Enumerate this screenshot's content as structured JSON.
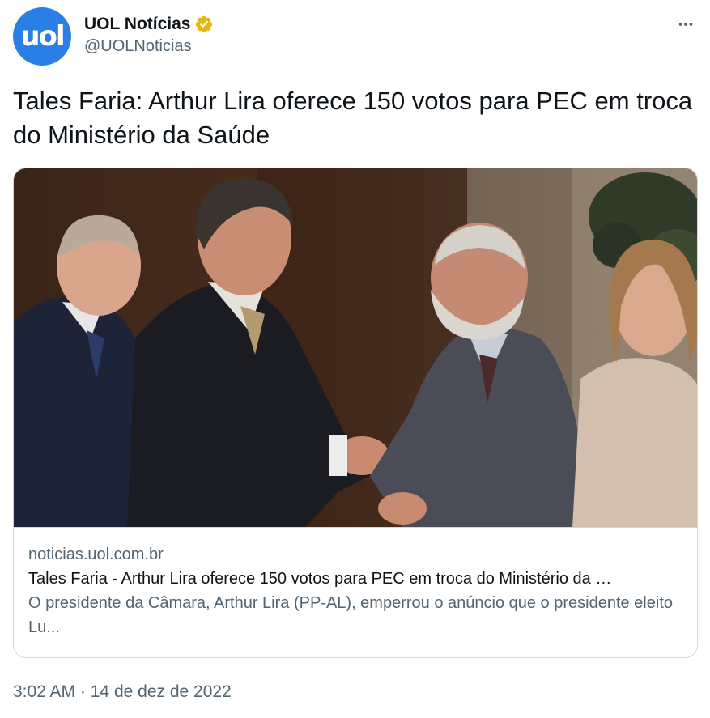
{
  "author": {
    "avatar_text": "uol",
    "display_name": "UOL Notícias",
    "handle": "@UOLNoticias"
  },
  "tweet": {
    "text": "Tales Faria: Arthur Lira oferece 150 votos para PEC em troca do Ministério da Saúde"
  },
  "card": {
    "domain": "noticias.uol.com.br",
    "title": "Tales Faria - Arthur Lira oferece 150 votos para PEC em troca do Ministério da …",
    "description": "O presidente da Câmara, Arthur Lira (PP-AL), emperrou o anúncio que o presidente eleito Lu..."
  },
  "meta": {
    "time": "3:02 AM",
    "separator": "·",
    "date": "14 de dez de 2022"
  },
  "icons": {
    "verified": "verified-badge-icon",
    "more": "more-options-icon"
  },
  "colors": {
    "avatar_bg": "#2a7fe6",
    "verified_gold": "#e2b719",
    "text_primary": "#0f1419",
    "text_secondary": "#536471",
    "border": "#cfd9de"
  }
}
